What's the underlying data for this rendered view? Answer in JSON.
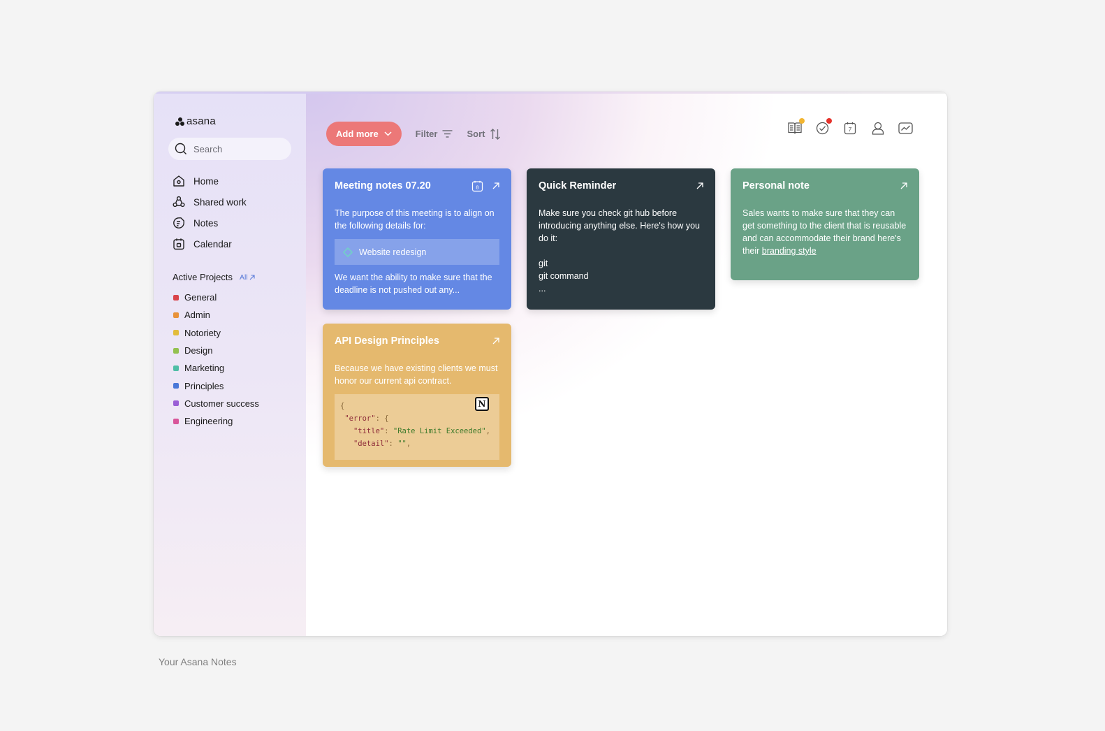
{
  "app": {
    "brand": "asana"
  },
  "sidebar": {
    "search_placeholder": "Search",
    "nav": [
      {
        "label": "Home",
        "icon": "home-icon"
      },
      {
        "label": "Shared work",
        "icon": "shared-work-icon"
      },
      {
        "label": "Notes",
        "icon": "notes-icon"
      },
      {
        "label": "Calendar",
        "icon": "calendar-icon"
      }
    ],
    "projects_title": "Active Projects",
    "projects_all": "All",
    "projects": [
      {
        "label": "General",
        "color": "#d9434a"
      },
      {
        "label": "Admin",
        "color": "#e8923a"
      },
      {
        "label": "Notoriety",
        "color": "#e2bc3c"
      },
      {
        "label": "Design",
        "color": "#93c150"
      },
      {
        "label": "Marketing",
        "color": "#4fbea6"
      },
      {
        "label": "Principles",
        "color": "#4a78d8"
      },
      {
        "label": "Customer success",
        "color": "#9a5fd6"
      },
      {
        "label": "Engineering",
        "color": "#d8559a"
      }
    ]
  },
  "toolbar": {
    "add_label": "Add more",
    "filter_label": "Filter",
    "sort_label": "Sort",
    "accent": "#ec7878"
  },
  "topicons": {
    "badge_yellow": "#f2b531",
    "badge_red": "#e5322b",
    "calendar_day": "7"
  },
  "cards": {
    "meeting": {
      "title": "Meeting notes 07.20",
      "calendar_day": "8",
      "intro": "The purpose of this meeting is to align on the following details for:",
      "project_link": "Website redesign",
      "outro": "We want the ability to make sure that the deadline is not pushed out any...",
      "color": "#6488e4"
    },
    "reminder": {
      "title": "Quick Reminder",
      "line1": "Make sure you check git hub before introducing anything else. Here's how you do it:",
      "line2": "git",
      "line3": "git command",
      "line4": "...",
      "color": "#2b3940"
    },
    "personal": {
      "title": "Personal note",
      "text": "Sales wants to make sure that they can get something to the client that is reusable and can accommodate their brand here's their ",
      "link": "branding style",
      "color": "#6aa287"
    },
    "api": {
      "title": "API Design Principles",
      "text": "Because we have existing clients we must honor our current api contract.",
      "code": {
        "brace": "{",
        "key_error": "\"error\"",
        "key_title": "\"title\"",
        "val_title": "\"Rate Limit Exceeded\"",
        "key_detail": "\"detail\"",
        "val_detail": "\"\""
      },
      "badge": "N",
      "color": "#e5b96e"
    }
  },
  "caption": "Your Asana Notes"
}
